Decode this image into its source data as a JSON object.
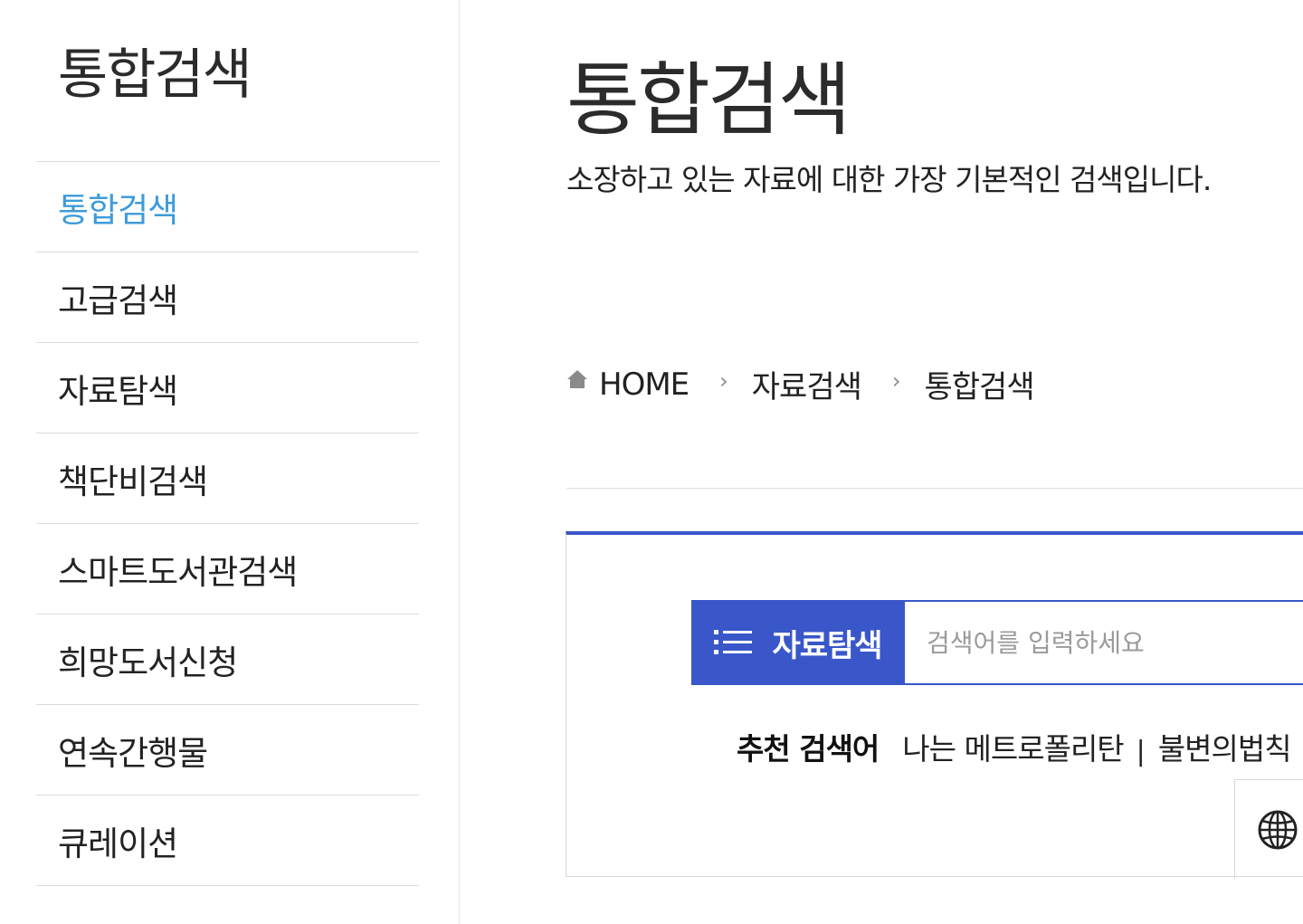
{
  "sidebar": {
    "title": "통합검색",
    "items": [
      {
        "label": "통합검색",
        "active": true
      },
      {
        "label": "고급검색",
        "active": false
      },
      {
        "label": "자료탐색",
        "active": false
      },
      {
        "label": "책단비검색",
        "active": false
      },
      {
        "label": "스마트도서관검색",
        "active": false
      },
      {
        "label": "희망도서신청",
        "active": false
      },
      {
        "label": "연속간행물",
        "active": false
      },
      {
        "label": "큐레이션",
        "active": false
      }
    ]
  },
  "main": {
    "title": "통합검색",
    "description": "소장하고 있는 자료에 대한 가장 기본적인 검색입니다."
  },
  "breadcrumb": {
    "icon": "home-icon",
    "items": [
      "HOME",
      "자료검색",
      "통합검색"
    ]
  },
  "search": {
    "category_label": "자료탐색",
    "category_icon": "list-icon",
    "placeholder": "검색어를 입력하세요",
    "recommend_label": "추천 검색어",
    "recommended": [
      "나는 메트로폴리탄",
      "불변의법칙"
    ],
    "globe_icon": "globe-icon"
  },
  "colors": {
    "accent_blue": "#3957c9",
    "active_menu": "#3e9bd9",
    "text": "#222222"
  }
}
